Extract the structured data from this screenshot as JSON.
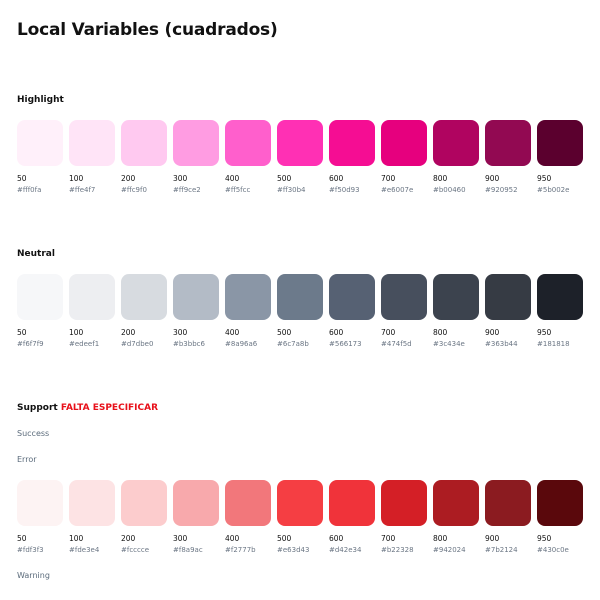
{
  "page": {
    "title": "Local Variables (cuadrados)"
  },
  "sections": {
    "highlight": {
      "title": "Highlight",
      "swatches": [
        {
          "step": "50",
          "hex": "#fff0fa",
          "color": "#fff0fa"
        },
        {
          "step": "100",
          "hex": "#ffe4f7",
          "color": "#ffe4f7"
        },
        {
          "step": "200",
          "hex": "#ffc9f0",
          "color": "#ffc9f0"
        },
        {
          "step": "300",
          "hex": "#ff9ce2",
          "color": "#ff9ce2"
        },
        {
          "step": "400",
          "hex": "#ff5fcc",
          "color": "#ff5fcc"
        },
        {
          "step": "500",
          "hex": "#ff30b4",
          "color": "#ff30b4"
        },
        {
          "step": "600",
          "hex": "#f50d93",
          "color": "#f50d93"
        },
        {
          "step": "700",
          "hex": "#e6007e",
          "color": "#e6007e"
        },
        {
          "step": "800",
          "hex": "#b00460",
          "color": "#b00460"
        },
        {
          "step": "900",
          "hex": "#920952",
          "color": "#920952"
        },
        {
          "step": "950",
          "hex": "#5b002e",
          "color": "#5b002e"
        }
      ]
    },
    "neutral": {
      "title": "Neutral",
      "swatches": [
        {
          "step": "50",
          "hex": "#f6f7f9",
          "color": "#f6f7f9"
        },
        {
          "step": "100",
          "hex": "#edeef1",
          "color": "#edeef1"
        },
        {
          "step": "200",
          "hex": "#d7dbe0",
          "color": "#d7dbe0"
        },
        {
          "step": "300",
          "hex": "#b3bbc6",
          "color": "#b3bbc6"
        },
        {
          "step": "400",
          "hex": "#8a96a6",
          "color": "#8a96a6"
        },
        {
          "step": "500",
          "hex": "#6c7a8b",
          "color": "#6c7a8b"
        },
        {
          "step": "600",
          "hex": "#566173",
          "color": "#566173"
        },
        {
          "step": "700",
          "hex": "#474f5d",
          "color": "#474f5d"
        },
        {
          "step": "800",
          "hex": "#3c434e",
          "color": "#3c434e"
        },
        {
          "step": "900",
          "hex": "#363b44",
          "color": "#363b44"
        },
        {
          "step": "950",
          "hex": "#181818",
          "color": "#1d2129"
        }
      ]
    },
    "support": {
      "title": "Support",
      "flag": "FALTA ESPECIFICAR",
      "flag_color": "#e8101a",
      "success_label": "Success",
      "error_label": "Error",
      "warning_label": "Warning",
      "error_swatches": [
        {
          "step": "50",
          "hex": "#fdf3f3",
          "color": "#fdf3f3"
        },
        {
          "step": "100",
          "hex": "#fde3e4",
          "color": "#fde3e4"
        },
        {
          "step": "200",
          "hex": "#fccccе",
          "color": "#fccccd"
        },
        {
          "step": "300",
          "hex": "#f8a9ac",
          "color": "#f8a9ac"
        },
        {
          "step": "400",
          "hex": "#f2777b",
          "color": "#f2777b"
        },
        {
          "step": "500",
          "hex": "#e63d43",
          "color": "#f53e43"
        },
        {
          "step": "600",
          "hex": "#d42e34",
          "color": "#f0333a"
        },
        {
          "step": "700",
          "hex": "#b22328",
          "color": "#d41f26"
        },
        {
          "step": "800",
          "hex": "#942024",
          "color": "#ac1c22"
        },
        {
          "step": "900",
          "hex": "#7b2124",
          "color": "#8b1b20"
        },
        {
          "step": "950",
          "hex": "#430c0e",
          "color": "#5a080c"
        }
      ]
    }
  }
}
